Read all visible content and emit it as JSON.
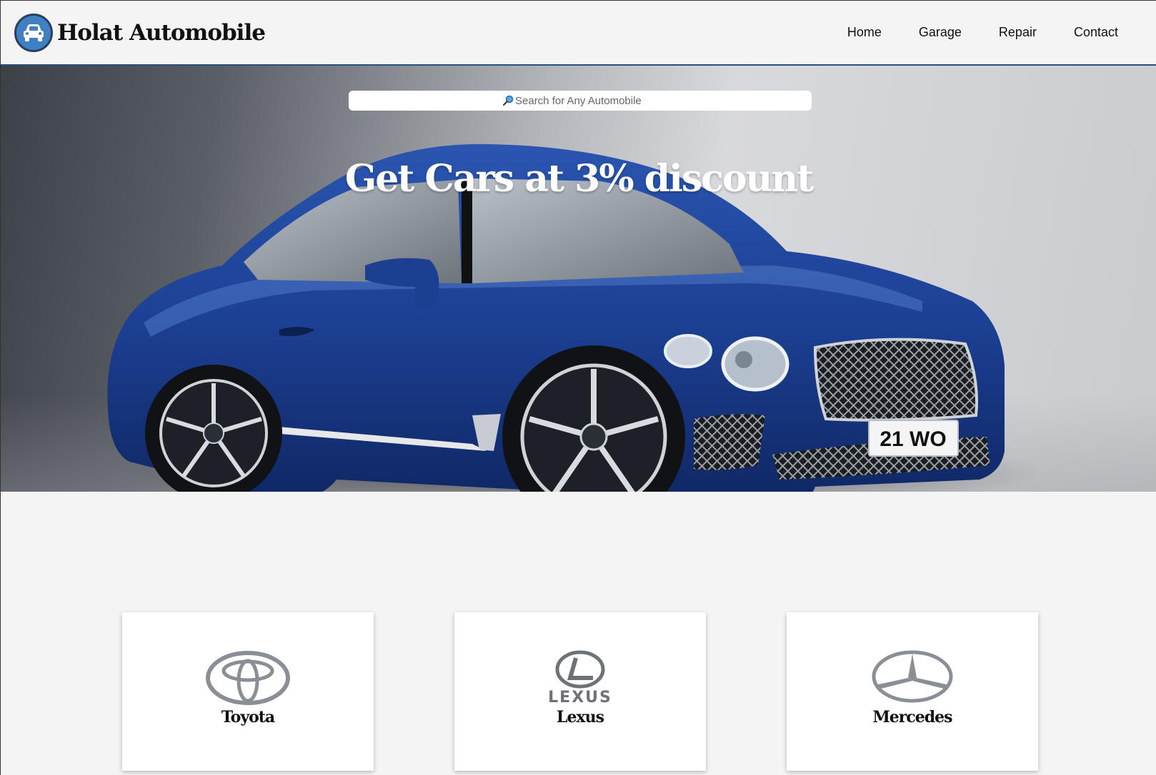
{
  "header": {
    "logo_text": "Holat Automobile",
    "logo_icon": "car-icon",
    "nav": [
      {
        "label": "Home"
      },
      {
        "label": "Garage"
      },
      {
        "label": "Repair"
      },
      {
        "label": "Contact"
      }
    ]
  },
  "hero": {
    "search_placeholder": "Search for Any Automobile",
    "search_icon": "magnifier-icon",
    "headline": "Get Cars at 3% discount",
    "image": "blue-coupe-car-image",
    "plate_text": "21 WO"
  },
  "brands": [
    {
      "name": "Toyota",
      "icon": "toyota-logo"
    },
    {
      "name": "Lexus",
      "icon": "lexus-logo",
      "wordmark": "LEXUS"
    },
    {
      "name": "Mercedes",
      "icon": "mercedes-logo"
    }
  ],
  "colors": {
    "accent": "#3f7fc4",
    "header_border": "#2d4f7c",
    "car_body": "#1f3f8f"
  }
}
